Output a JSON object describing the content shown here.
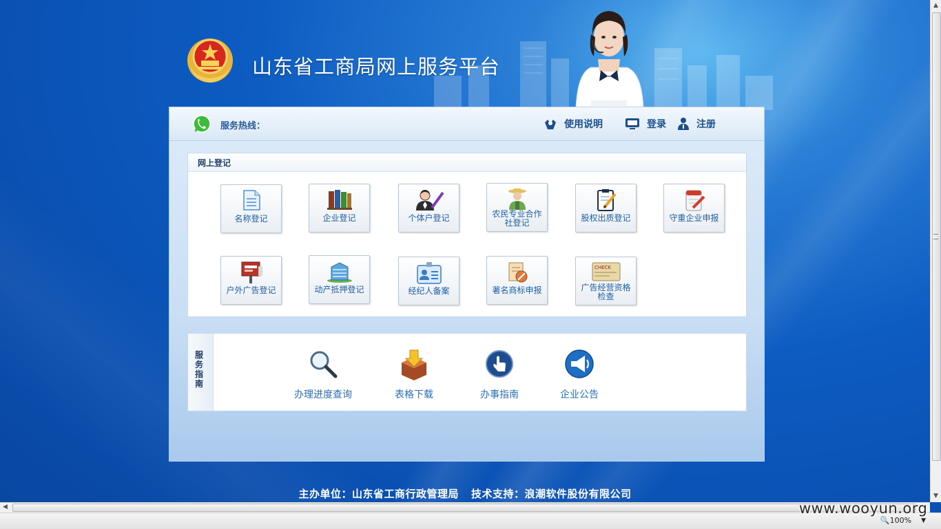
{
  "header": {
    "site_title": "山东省工商局网上服务平台"
  },
  "service_bar": {
    "hotline_label": "服务热线：",
    "nav": [
      {
        "label": "使用说明",
        "icon": "help-hands-icon"
      },
      {
        "label": "登录",
        "icon": "monitor-icon"
      },
      {
        "label": "注册",
        "icon": "user-icon"
      }
    ]
  },
  "registration": {
    "title": "网上登记",
    "tiles": [
      {
        "label": "名称登记",
        "icon": "document-icon"
      },
      {
        "label": "企业登记",
        "icon": "books-icon"
      },
      {
        "label": "个体户登记",
        "icon": "person-pen-icon"
      },
      {
        "label": "农民专业合作社登记",
        "icon": "farmer-icon"
      },
      {
        "label": "股权出质登记",
        "icon": "clipboard-pen-icon"
      },
      {
        "label": "守重企业申报",
        "icon": "notepad-icon"
      },
      {
        "label": "户外广告登记",
        "icon": "billboard-icon"
      },
      {
        "label": "动产抵押登记",
        "icon": "building-icon"
      },
      {
        "label": "经纪人备案",
        "icon": "id-badge-icon"
      },
      {
        "label": "著名商标申报",
        "icon": "trademark-icon"
      },
      {
        "label": "广告经营资格检查",
        "icon": "check-card-icon"
      }
    ]
  },
  "guide": {
    "side_label": "服务指南",
    "items": [
      {
        "label": "办理进度查询",
        "icon": "magnifier-icon"
      },
      {
        "label": "表格下载",
        "icon": "download-box-icon"
      },
      {
        "label": "办事指南",
        "icon": "hand-pointer-icon"
      },
      {
        "label": "企业公告",
        "icon": "megaphone-icon"
      }
    ]
  },
  "footer": {
    "host": "主办单位：山东省工商行政管理局",
    "support": "技术支持：浪潮软件股份有限公司"
  },
  "browser": {
    "zoom": "100%",
    "watermark": "www.wooyun.org"
  }
}
